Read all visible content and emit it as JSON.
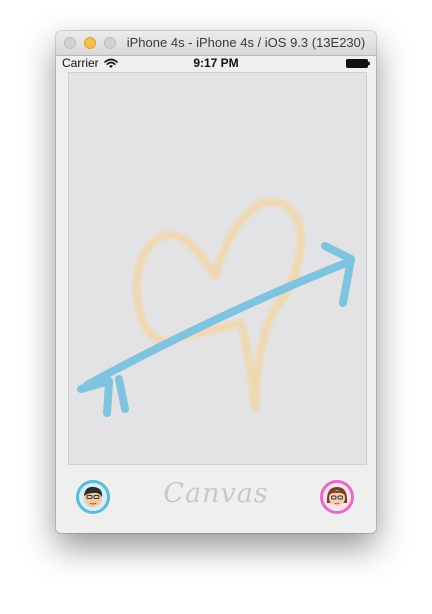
{
  "window": {
    "title": "iPhone 4s - iPhone 4s / iOS 9.3 (13E230)",
    "controls": [
      "close",
      "minimize",
      "zoom"
    ]
  },
  "status_bar": {
    "carrier": "Carrier",
    "time": "9:17 PM",
    "icons": [
      "wifi-icon",
      "battery-icon"
    ]
  },
  "canvas": {
    "drawing": [
      "heart",
      "arrow"
    ],
    "colors": {
      "background": "#e3e3e5",
      "heart_stroke": "#f2d6a8",
      "arrow_stroke": "#7ec4e0"
    }
  },
  "bottom_bar": {
    "brand": "Canvas",
    "left_avatar": "boy-avatar",
    "right_avatar": "girl-avatar",
    "left_avatar_ring": "#5bbbd8",
    "right_avatar_ring": "#e56dc4"
  }
}
